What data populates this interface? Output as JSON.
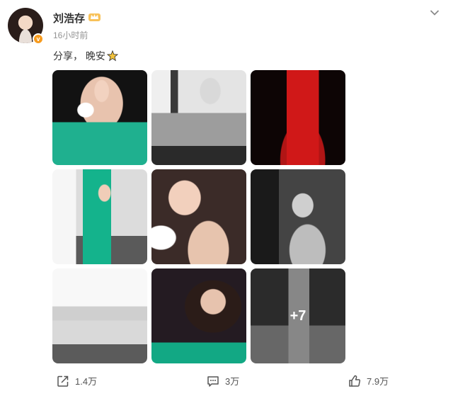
{
  "post": {
    "author": {
      "name": "刘浩存",
      "badge": "v"
    },
    "time": "16小时前",
    "text": "分享， 晚安",
    "images": [
      {
        "alt": "photo-1"
      },
      {
        "alt": "photo-2"
      },
      {
        "alt": "photo-3"
      },
      {
        "alt": "photo-4"
      },
      {
        "alt": "photo-5"
      },
      {
        "alt": "photo-6"
      },
      {
        "alt": "photo-7"
      },
      {
        "alt": "photo-8"
      },
      {
        "alt": "photo-9"
      }
    ],
    "more_count": "+7"
  },
  "actions": {
    "share": "1.4万",
    "comment": "3万",
    "like": "7.9万"
  },
  "colors": {
    "accent": "#f79b1e",
    "text": "#333333",
    "muted": "#939393"
  },
  "icons": [
    "avatar",
    "vip-crown-icon",
    "chevron-down-icon",
    "sparkle-star-icon",
    "share-icon",
    "comment-icon",
    "like-icon"
  ]
}
